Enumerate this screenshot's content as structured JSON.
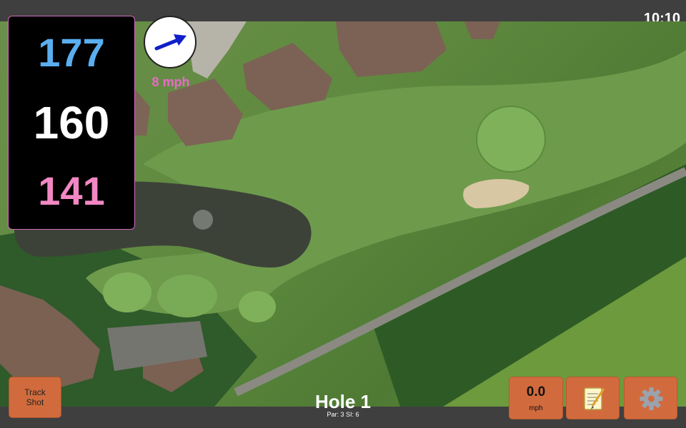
{
  "status": {
    "time": "10:10"
  },
  "distances": {
    "back": "177",
    "middle": "160",
    "front": "141"
  },
  "wind": {
    "speed_label": "8 mph",
    "arrow_icon": "wind-arrow-icon"
  },
  "buttons": {
    "track_line1": "Track",
    "track_line2": "Shot",
    "speed_value": "0.0",
    "speed_unit": "mph",
    "notes_icon": "notepad-icon",
    "settings_icon": "gear-icon"
  },
  "hole": {
    "title": "Hole 1",
    "par_si": "Par: 3   SI: 6"
  },
  "colors": {
    "back": "#5aaef0",
    "middle": "#ffffff",
    "front": "#f288c3",
    "button": "#d16b3d",
    "accent": "#d36ac0"
  }
}
